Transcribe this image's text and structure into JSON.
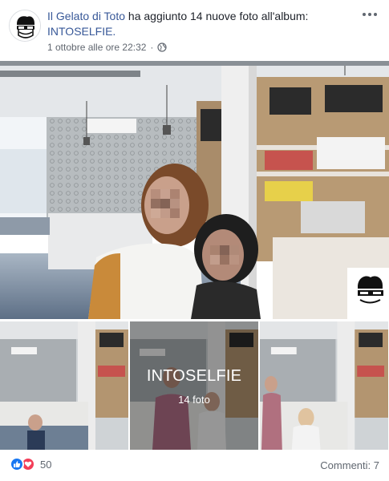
{
  "post": {
    "page_name": "Il Gelato di Toto",
    "action_text": " ha aggiunto 14 nuove foto all'album: ",
    "album_link": "INTOSELFIE.",
    "timestamp": "1 ottobre alle ore 22:32",
    "separator": "·",
    "privacy_icon": "globe-icon",
    "more_icon": "more-options-icon"
  },
  "album": {
    "title": "INTOSELFIE",
    "count_label": "14 foto"
  },
  "footer": {
    "reaction_icons": [
      "like-icon",
      "love-icon"
    ],
    "reaction_count": "50",
    "comments_label": "Commenti: 7"
  },
  "colors": {
    "link": "#385898",
    "meta": "#616770",
    "like": "#1877f2",
    "love": "#f33e58"
  }
}
